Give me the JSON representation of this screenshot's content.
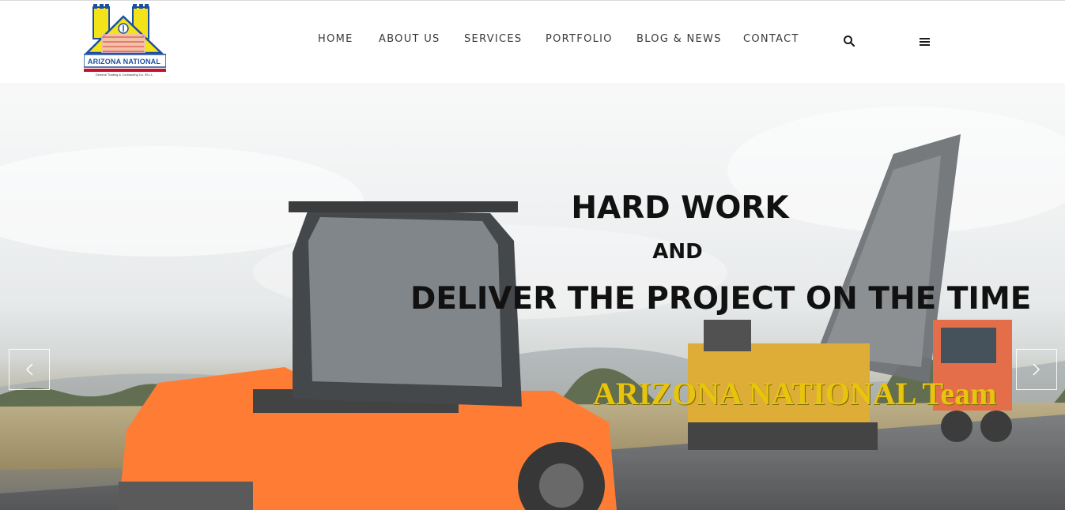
{
  "logo": {
    "name": "ARIZONA NATIONAL",
    "subtitle": "General Trading & Contracting Co. W.L.L"
  },
  "nav": {
    "items": [
      {
        "label": "HOME"
      },
      {
        "label": "ABOUT US"
      },
      {
        "label": "SERVICES"
      },
      {
        "label": "PORTFOLIO"
      },
      {
        "label": "BLOG & NEWS"
      },
      {
        "label": "CONTACT"
      }
    ],
    "icons": [
      "search-icon",
      "menu-icon"
    ]
  },
  "hero": {
    "line1": "HARD WORK",
    "line2": "AND",
    "line3": "DELIVER THE PROJECT ON THE TIME",
    "brand": "ARIZONA NATIONAL Team",
    "icons": [
      "chevron-left-icon",
      "chevron-right-icon"
    ]
  },
  "colors": {
    "nav_text": "#3a3a3a",
    "hero_text": "#111111",
    "brand_gold": "#e8c40e",
    "logo_blue": "#1d4fa0",
    "logo_yellow": "#f5e31a",
    "logo_red": "#c8102e",
    "machine_orange": "#ff6a1a"
  }
}
